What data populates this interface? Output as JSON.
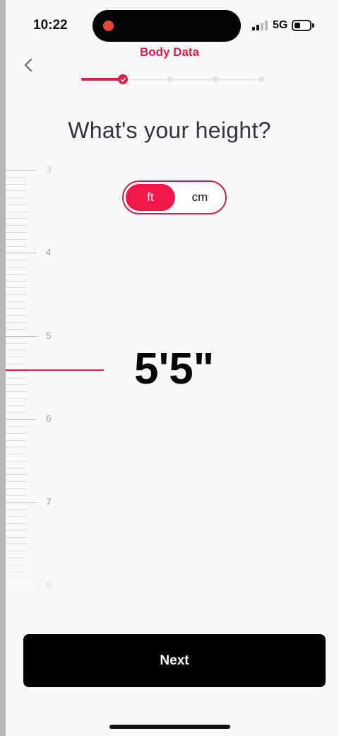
{
  "status_bar": {
    "time": "10:22",
    "network": "5G"
  },
  "header": {
    "title": "Body Data"
  },
  "progress": {
    "current_step": 1,
    "total_steps": 5
  },
  "question": "What's your height?",
  "unit_toggle": {
    "options": [
      "ft",
      "cm"
    ],
    "selected": "ft"
  },
  "ruler": {
    "labels": [
      "3",
      "4",
      "5",
      "6",
      "7",
      "8"
    ]
  },
  "height_value": "5'5\"",
  "next_button": {
    "label": "Next"
  },
  "colors": {
    "accent": "#d8204a",
    "toggle_active": "#f0174a",
    "button": "#000000"
  }
}
